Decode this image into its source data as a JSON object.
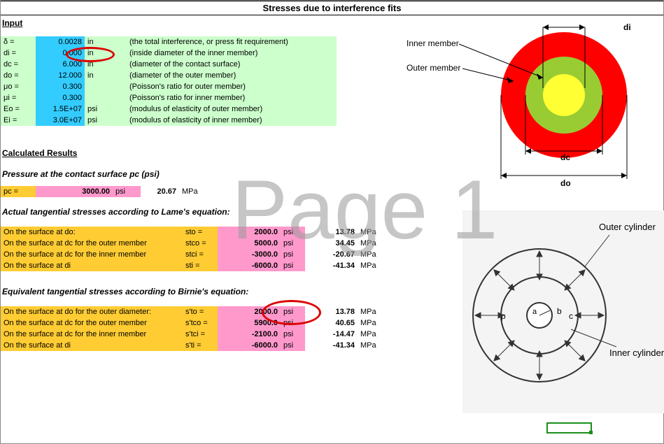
{
  "title": "Stresses due to interference fits",
  "watermark": "Page 1",
  "input_heading": "Input",
  "inputs": [
    {
      "sym": "δ =",
      "val": "0.0028",
      "unit": "in",
      "desc": "(the total interference, or press fit requirement)"
    },
    {
      "sym": "di =",
      "val": "0.000",
      "unit": "in",
      "desc": "(inside diameter of the inner member)"
    },
    {
      "sym": "dc =",
      "val": "6.000",
      "unit": "in",
      "desc": "(diameter of the contact surface)"
    },
    {
      "sym": "do =",
      "val": "12.000",
      "unit": "in",
      "desc": "(diameter of the outer member)"
    },
    {
      "sym": "μo =",
      "val": "0.300",
      "unit": "",
      "desc": "(Poisson's ratio for outer member)"
    },
    {
      "sym": "μi =",
      "val": "0.300",
      "unit": "",
      "desc": "(Poisson's ratio for inner member)"
    },
    {
      "sym": "Eo =",
      "val": "1.5E+07",
      "unit": "psi",
      "desc": "(modulus of elasticity of outer member)"
    },
    {
      "sym": "Ei =",
      "val": "3.0E+07",
      "unit": "psi",
      "desc": "(modulus of elasticity of inner member)"
    }
  ],
  "calc_heading": "Calculated Results",
  "pressure_heading": "Pressure at the contact surface pc (psi)",
  "pressure": {
    "sym": "pc =",
    "val": "3000.00",
    "unit": "psi",
    "alt_val": "20.67",
    "alt_unit": "MPa"
  },
  "lame_heading": "Actual tangential stresses according to Lame's equation:",
  "lame_rows": [
    {
      "label": "On the surface at do:",
      "sym": "sto =",
      "val": "2000.0",
      "unit": "psi",
      "alt": "13.78",
      "alt_unit": "MPa"
    },
    {
      "label": "On the surface at dc for the outer member",
      "sym": "stco =",
      "val": "5000.0",
      "unit": "psi",
      "alt": "34.45",
      "alt_unit": "MPa"
    },
    {
      "label": "On the surface at dc for the inner member",
      "sym": "stci =",
      "val": "-3000.0",
      "unit": "psi",
      "alt": "-20.67",
      "alt_unit": "MPa"
    },
    {
      "label": "On the surface at di",
      "sym": "sti =",
      "val": "-6000.0",
      "unit": "psi",
      "alt": "-41.34",
      "alt_unit": "MPa"
    }
  ],
  "birnie_heading": "Equivalent tangential stresses according to Birnie's equation:",
  "birnie_rows": [
    {
      "label": "On the surface at do for the outer diameter:",
      "sym": "s'to =",
      "val": "2000.0",
      "unit": "psi",
      "alt": "13.78",
      "alt_unit": "MPa"
    },
    {
      "label": "On the surface at dc for the outer member",
      "sym": "s'tco =",
      "val": "5900.0",
      "unit": "psi",
      "alt": "40.65",
      "alt_unit": "MPa"
    },
    {
      "label": "On the surface at dc for the inner member",
      "sym": "s'tci =",
      "val": "-2100.0",
      "unit": "psi",
      "alt": "-14.47",
      "alt_unit": "MPa"
    },
    {
      "label": "On the surface at di",
      "sym": "s'ti =",
      "val": "-6000.0",
      "unit": "psi",
      "alt": "-41.34",
      "alt_unit": "MPa"
    }
  ],
  "diagram_top": {
    "inner_label": "Inner member",
    "outer_label": "Outer member",
    "di": "di",
    "dc": "dc",
    "do": "do"
  },
  "diagram_bottom": {
    "outer": "Outer cylinder",
    "inner": "Inner cylinder",
    "p": "p",
    "a": "a",
    "b": "b",
    "c": "c"
  }
}
